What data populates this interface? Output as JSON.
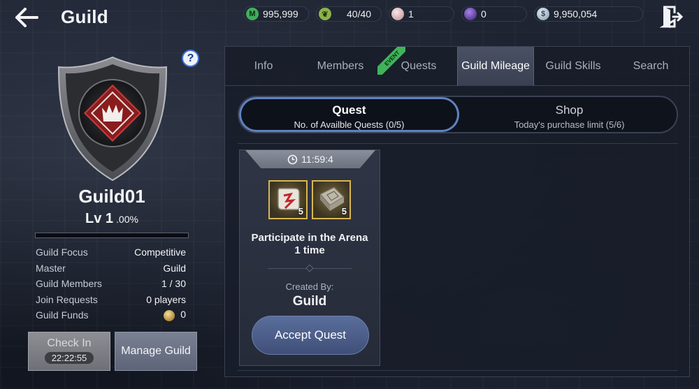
{
  "header": {
    "title": "Guild",
    "resources": [
      {
        "icon": "mileage-m-icon",
        "value": "995,999",
        "color": "#3fae5b"
      },
      {
        "icon": "stamina-leaf-icon",
        "value": "40/40",
        "color": "#8ab34a"
      },
      {
        "icon": "pearl-icon",
        "value": "1",
        "color": "#d9b0b3"
      },
      {
        "icon": "purple-orb-icon",
        "value": "0",
        "color": "#6a3fb5"
      },
      {
        "icon": "silver-coin-icon",
        "value": "9,950,054",
        "color": "#9cb3c9"
      }
    ]
  },
  "guild": {
    "name": "Guild01",
    "level": "Lv 1",
    "level_percent": ".00%",
    "xp_fraction": 0,
    "details": [
      {
        "label": "Guild Focus",
        "value": "Competitive"
      },
      {
        "label": "Master",
        "value": "Guild"
      },
      {
        "label": "Guild Members",
        "value": "1 / 30"
      },
      {
        "label": "Join Requests",
        "value": "0 players"
      },
      {
        "label": "Guild Funds",
        "value": "0"
      }
    ],
    "check_in_label": "Check In",
    "check_in_timer": "22:22:55",
    "manage_label": "Manage Guild"
  },
  "tabs": [
    {
      "label": "Info"
    },
    {
      "label": "Members"
    },
    {
      "label": "Quests",
      "badge": "EVENT"
    },
    {
      "label": "Guild Mileage",
      "active": true
    },
    {
      "label": "Guild Skills"
    },
    {
      "label": "Search"
    }
  ],
  "segments": {
    "quest": {
      "title": "Quest",
      "subtitle": "No. of Availble Quests (0/5)"
    },
    "shop": {
      "title": "Shop",
      "subtitle": "Today's purchase limit (5/6)"
    }
  },
  "quest_card": {
    "timer": "11:59:4",
    "rewards": [
      {
        "icon": "scroll-icon",
        "qty": "5"
      },
      {
        "icon": "stone-tablet-icon",
        "qty": "5"
      }
    ],
    "title_line1": "Participate in the Arena",
    "title_line2": "1 time",
    "created_by_label": "Created By:",
    "created_by_value": "Guild",
    "accept_label": "Accept Quest"
  }
}
